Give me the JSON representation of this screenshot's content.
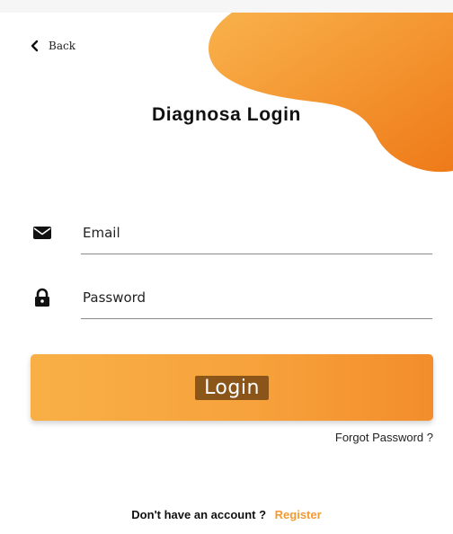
{
  "app": {
    "back_label": "Back",
    "title": "Diagnosa Login"
  },
  "form": {
    "email_placeholder": "Email",
    "email_value": "",
    "password_placeholder": "Password",
    "password_value": "",
    "login_label": "Login",
    "forgot_label": "Forgot Password ?"
  },
  "footer": {
    "question": "Don't have an account ?",
    "register_label": "Register"
  },
  "icons": {
    "back": "chevron-left-icon",
    "email": "envelope-icon",
    "password": "lock-icon"
  },
  "colors": {
    "accent": "#f7a23c",
    "accent_dark": "#f07f1c",
    "register": "#f39a35",
    "login_label_bg": "#7a4a16"
  }
}
